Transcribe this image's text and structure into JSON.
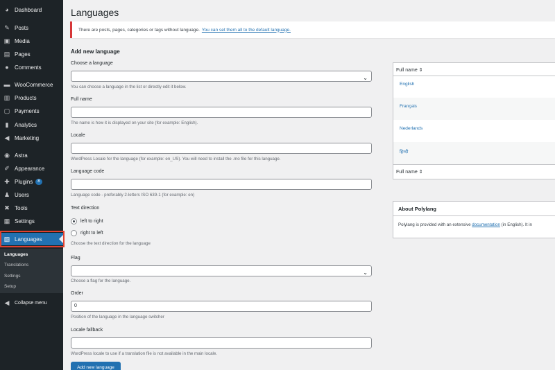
{
  "sidebar": {
    "items": [
      {
        "label": "Dashboard",
        "icon": "dashboard-icon",
        "glyph": "◕"
      },
      {
        "label": "Posts",
        "icon": "pin-icon",
        "glyph": "✎"
      },
      {
        "label": "Media",
        "icon": "media-icon",
        "glyph": "▣"
      },
      {
        "label": "Pages",
        "icon": "pages-icon",
        "glyph": "▤"
      },
      {
        "label": "Comments",
        "icon": "comment-icon",
        "glyph": "●"
      },
      {
        "label": "WooCommerce",
        "icon": "woo-icon",
        "glyph": "▬"
      },
      {
        "label": "Products",
        "icon": "products-icon",
        "glyph": "▥"
      },
      {
        "label": "Payments",
        "icon": "payments-icon",
        "glyph": "▢"
      },
      {
        "label": "Analytics",
        "icon": "analytics-icon",
        "glyph": "▮"
      },
      {
        "label": "Marketing",
        "icon": "megaphone-icon",
        "glyph": "◀"
      },
      {
        "label": "Astra",
        "icon": "astra-icon",
        "glyph": "◉"
      },
      {
        "label": "Appearance",
        "icon": "brush-icon",
        "glyph": "✐"
      },
      {
        "label": "Plugins",
        "icon": "plugin-icon",
        "glyph": "✚",
        "badge": "8"
      },
      {
        "label": "Users",
        "icon": "user-icon",
        "glyph": "♟"
      },
      {
        "label": "Tools",
        "icon": "wrench-icon",
        "glyph": "✖"
      },
      {
        "label": "Settings",
        "icon": "settings-icon",
        "glyph": "▦"
      },
      {
        "label": "Languages",
        "icon": "translate-icon",
        "glyph": "▧"
      }
    ],
    "submenu": [
      "Languages",
      "Translations",
      "Settings",
      "Setup"
    ],
    "collapse": {
      "label": "Collapse menu",
      "glyph": "◀"
    }
  },
  "page": {
    "title": "Languages",
    "notice_text": "There are posts, pages, categories or tags without language.",
    "notice_link": "You can set them all to the default language."
  },
  "form": {
    "heading": "Add new language",
    "choose_label": "Choose a language",
    "choose_desc": "You can choose a language in the list or directly edit it below.",
    "fullname_label": "Full name",
    "fullname_desc": "The name is how it is displayed on your site (for example: English).",
    "locale_label": "Locale",
    "locale_desc": "WordPress Locale for the language (for example: en_US). You will need to install the .mo file for this language.",
    "code_label": "Language code",
    "code_desc": "Language code - preferably 2-letters ISO 639-1 (for example: en)",
    "direction_label": "Text direction",
    "ltr": "left to right",
    "rtl": "right to left",
    "direction_desc": "Choose the text direction for the language",
    "flag_label": "Flag",
    "flag_desc": "Choose a flag for the language.",
    "order_label": "Order",
    "order_value": "0",
    "order_desc": "Position of the language in the language switcher",
    "fallback_label": "Locale fallback",
    "fallback_desc": "WordPress locale to use if a translation file is not available in the main locale.",
    "submit": "Add new language"
  },
  "table": {
    "header": "Full name ⇕",
    "footer": "Full name ⇕",
    "rows": [
      "English",
      "Français",
      "Nederlands",
      "हिन्दी"
    ]
  },
  "about": {
    "title": "About Polylang",
    "text_before": "Polylang is provided with an extensive",
    "link": "documentation",
    "text_after": "(in English). It in"
  },
  "colors": {
    "sidebar": "#1d2327",
    "accent": "#2271b1",
    "highlight": "#e0402e",
    "notice_border": "#d63638"
  }
}
